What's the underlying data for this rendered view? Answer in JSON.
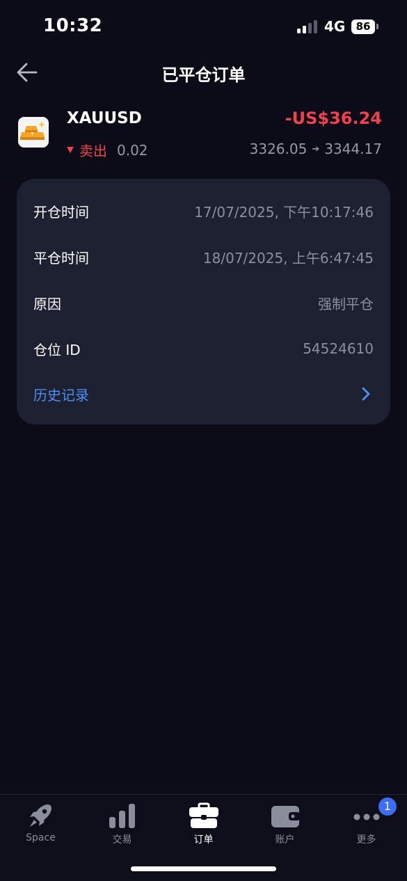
{
  "status_bar": {
    "time": "10:32",
    "network": "4G",
    "battery": "86"
  },
  "nav": {
    "title": "已平仓订单"
  },
  "instrument": {
    "symbol": "XAUUSD",
    "pnl": "-US$36.24",
    "side": "卖出",
    "volume": "0.02",
    "open_price": "3326.05",
    "close_price": "3344.17",
    "icon": "gold-bars-icon"
  },
  "details": {
    "rows": [
      {
        "label": "开仓时间",
        "value": "17/07/2025, 下午10:17:46"
      },
      {
        "label": "平仓时间",
        "value": "18/07/2025, 上午6:47:45"
      },
      {
        "label": "原因",
        "value": "强制平仓"
      },
      {
        "label": "仓位 ID",
        "value": "54524610"
      }
    ],
    "history_label": "历史记录"
  },
  "tabs": [
    {
      "label": "Space",
      "icon": "rocket-icon",
      "active": false
    },
    {
      "label": "交易",
      "icon": "bar-chart-icon",
      "active": false
    },
    {
      "label": "订单",
      "icon": "briefcase-icon",
      "active": true
    },
    {
      "label": "账户",
      "icon": "wallet-icon",
      "active": false
    },
    {
      "label": "更多",
      "icon": "more-dots-icon",
      "active": false
    }
  ],
  "more_badge": "1",
  "colors": {
    "background": "#0b0c18",
    "card": "#1d2030",
    "loss": "#f0414c",
    "link": "#4b8ff7",
    "badge": "#3b6df5"
  }
}
